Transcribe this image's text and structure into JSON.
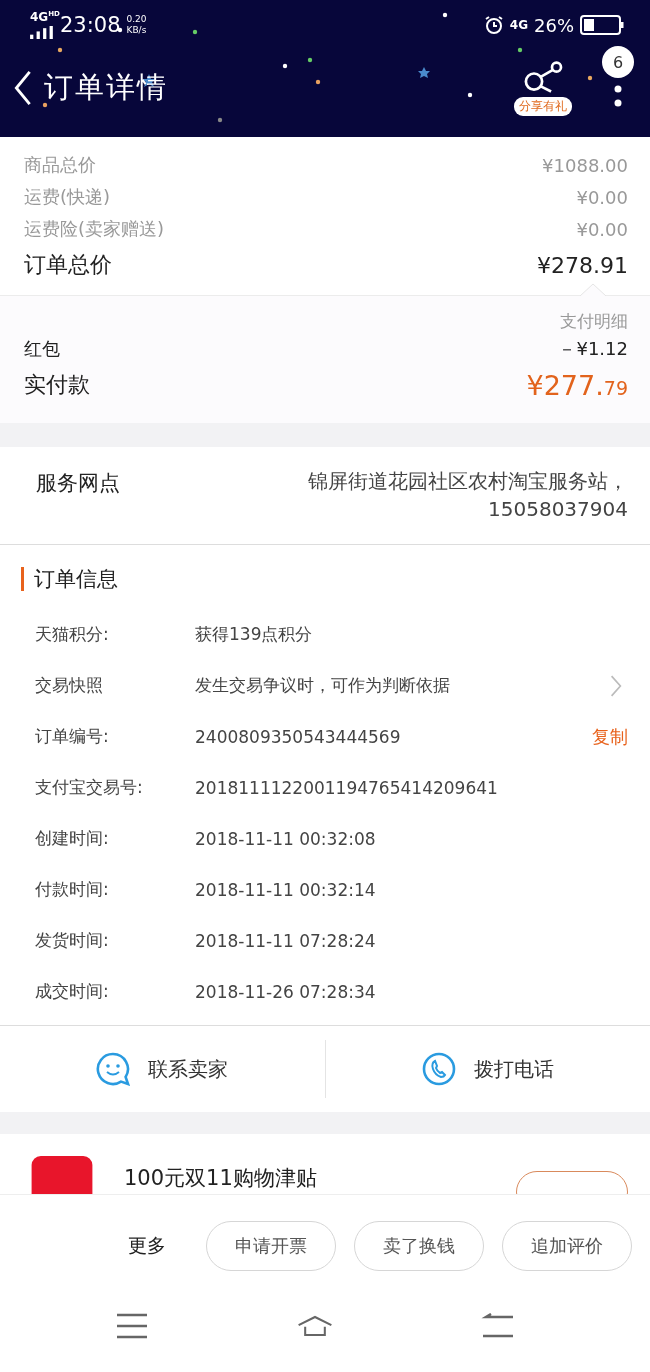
{
  "status_bar": {
    "network": "4G",
    "network_sup": "HD",
    "time": "23:08",
    "speed": "0.20",
    "speed_unit": "KB/s",
    "data": "4G",
    "battery": "26%"
  },
  "header": {
    "title": "订单详情",
    "share_label": "分享有礼",
    "badge": "6"
  },
  "price_lines": [
    {
      "label": "商品总价",
      "value": "¥1088.00",
      "kind": "minor"
    },
    {
      "label": "运费(快递)",
      "value": "¥0.00",
      "kind": "minor"
    },
    {
      "label": "运费险(卖家赠送)",
      "value": "¥0.00",
      "kind": "minor"
    },
    {
      "label": "订单总价",
      "value": "¥278.91",
      "kind": "major"
    }
  ],
  "payment": {
    "details_link": "支付明细",
    "discount_label": "红包",
    "discount_value": "－¥1.12",
    "paid_label": "实付款",
    "paid_main": "¥277.",
    "paid_cents": "79"
  },
  "service": {
    "label": "服务网点",
    "value": "锦屏街道花园社区农村淘宝服务站，15058037904"
  },
  "order_info": {
    "title": "订单信息",
    "rows": [
      {
        "label": "天猫积分:",
        "value": "获得139点积分",
        "kind": "plain"
      },
      {
        "label": "交易快照",
        "value": "发生交易争议时，可作为判断依据",
        "kind": "link"
      },
      {
        "label": "订单编号:",
        "value": "2400809350543444569",
        "kind": "copy",
        "action": "复制"
      },
      {
        "label": "支付宝交易号:",
        "value": "2018111122001194765414209641",
        "kind": "plain"
      },
      {
        "label": "创建时间:",
        "value": "2018-11-11 00:32:08",
        "kind": "plain"
      },
      {
        "label": "付款时间:",
        "value": "2018-11-11 00:32:14",
        "kind": "plain"
      },
      {
        "label": "发货时间:",
        "value": "2018-11-11 07:28:24",
        "kind": "plain"
      },
      {
        "label": "成交时间:",
        "value": "2018-11-26 07:28:34",
        "kind": "plain"
      }
    ]
  },
  "contact": [
    {
      "label": "联系卖家",
      "kind": "chat"
    },
    {
      "label": "拨打电话",
      "kind": "phone"
    }
  ],
  "promo": {
    "title": "100元双11购物津贴"
  },
  "actions": {
    "more": "更多",
    "buttons": [
      "申请开票",
      "卖了换钱",
      "追加评价"
    ]
  }
}
